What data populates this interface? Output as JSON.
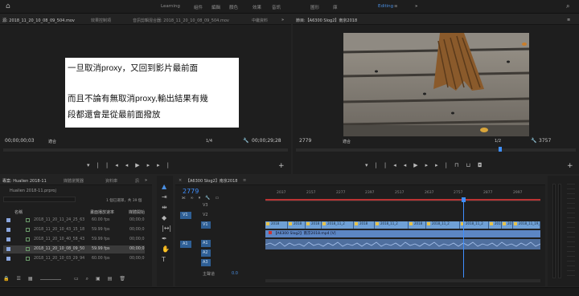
{
  "topbar": {
    "workspaces": [
      "Learning",
      "組件",
      "編輯",
      "顏色",
      "效果",
      "音訊",
      "圖形",
      "庫",
      "Editing"
    ],
    "active": "Editing"
  },
  "source": {
    "tabs": [
      "源: 2018_11_20_10_08_09_504.mov",
      "效果控制項",
      "音訊剪輯混合器: 2018_11_20_10_08_09_504.mov",
      "中繼資料"
    ],
    "timecode_left": "00;00;00;03",
    "fit": "適合",
    "resolution": "1/4",
    "timecode_right": "00;00;29;28"
  },
  "overlay": {
    "line1": "一旦取消proxy，又回到影片最前面",
    "line2": "而且不論有無取消proxy,輸出結果有幾",
    "line3": "段都還會是從最前面撥放"
  },
  "program": {
    "title": "節目:【A6300 Slog2】南京2018",
    "timecode_left": "2779",
    "fit": "適合",
    "resolution": "1/2",
    "timecode_right": "3757"
  },
  "project": {
    "tabs": [
      "專案: Hualien 2018-11",
      "媒體瀏覽器",
      "資料庫",
      "訊"
    ],
    "breadcrumb": "Hualien 2018-11.prproj",
    "selection": "1 個已選擇，共 39 個",
    "columns": [
      "名稱",
      "畫面播放速率",
      "媒體開始"
    ],
    "rows": [
      {
        "name": "2018_11_20_11_24_25_63",
        "fps": "60.00 fps",
        "start": "00;00;0"
      },
      {
        "name": "2018_11_20_10_43_15_18",
        "fps": "59.99 fps",
        "start": "00;00;0"
      },
      {
        "name": "2018_11_20_10_40_58_43",
        "fps": "59.99 fps",
        "start": "00;00;0"
      },
      {
        "name": "2018_11_20_10_08_09_50",
        "fps": "59.99 fps",
        "start": "00;00;0"
      },
      {
        "name": "2018_11_20_10_03_29_94",
        "fps": "60.00 fps",
        "start": "00;00;0"
      }
    ]
  },
  "timeline": {
    "title": "【A6300 Slog2】南京2018",
    "timecode": "2779",
    "ruler": [
      "2037",
      "2157",
      "2277",
      "2397",
      "2517",
      "2637",
      "2757",
      "2877",
      "2997"
    ],
    "tracks_video": [
      "V3",
      "V2",
      "V1"
    ],
    "tracks_audio": [
      "A1",
      "A2",
      "A3"
    ],
    "master": "主聲道",
    "master_value": "0.0",
    "clip_labels": [
      "2018",
      "2018",
      "2018",
      "2018_11_2",
      "2018",
      "2018_11_2",
      "2018",
      "2018_11_2",
      "2018_11_2",
      "2018",
      "2018",
      "2018_11_19_1"
    ],
    "v2_clip": "【A6300 Slog2】南京2018.mp4 [V]"
  },
  "colors": {
    "accent": "#4a8fe2",
    "clip": "#6fa0d6",
    "audio": "#5c7fb8",
    "playhead": "#3f8fff"
  }
}
